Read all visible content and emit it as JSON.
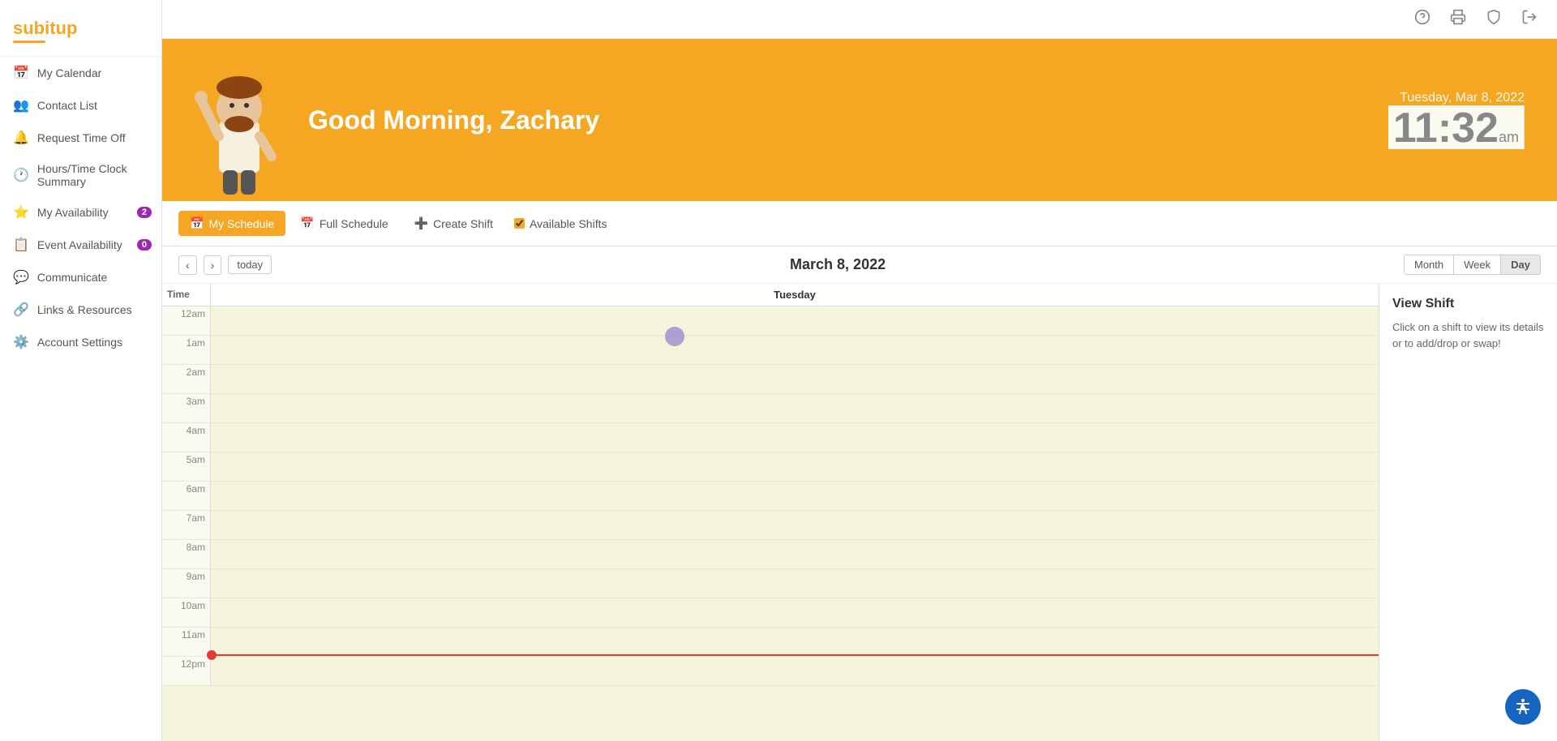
{
  "app": {
    "logo": "subitup",
    "logo_tagline": "~"
  },
  "topbar": {
    "icons": [
      "help-icon",
      "print-icon",
      "shield-icon",
      "power-icon"
    ]
  },
  "hero": {
    "greeting": "Good Morning, Zachary",
    "date_label": "Tuesday, Mar 8, 2022",
    "time_value": "11:32",
    "time_ampm": "am"
  },
  "sidebar": {
    "items": [
      {
        "id": "my-calendar",
        "label": "My Calendar",
        "icon": "📅",
        "badge": null
      },
      {
        "id": "contact-list",
        "label": "Contact List",
        "icon": "👥",
        "badge": null
      },
      {
        "id": "request-time-off",
        "label": "Request Time Off",
        "icon": "🔔",
        "badge": null
      },
      {
        "id": "hours-time-clock",
        "label": "Hours/Time Clock Summary",
        "icon": "🕐",
        "badge": null
      },
      {
        "id": "my-availability",
        "label": "My Availability",
        "icon": "⭐",
        "badge": "2"
      },
      {
        "id": "event-availability",
        "label": "Event Availability",
        "icon": "📋",
        "badge": "0"
      },
      {
        "id": "communicate",
        "label": "Communicate",
        "icon": "💬",
        "badge": null
      },
      {
        "id": "links-resources",
        "label": "Links & Resources",
        "icon": "🔗",
        "badge": null
      },
      {
        "id": "account-settings",
        "label": "Account Settings",
        "icon": "⚙️",
        "badge": null
      }
    ]
  },
  "tabs": [
    {
      "id": "my-schedule",
      "label": "My Schedule",
      "icon": "📅",
      "active": true
    },
    {
      "id": "full-schedule",
      "label": "Full Schedule",
      "icon": "📅",
      "active": false
    },
    {
      "id": "create-shift",
      "label": "Create Shift",
      "icon": "➕",
      "active": false
    }
  ],
  "available_shifts": {
    "label": "Available Shifts",
    "checked": true
  },
  "calendar": {
    "title": "March 8, 2022",
    "day_label": "Tuesday",
    "nav_prev": "‹",
    "nav_next": "›",
    "today_label": "today",
    "view_buttons": [
      {
        "label": "Month",
        "active": false
      },
      {
        "label": "Week",
        "active": false
      },
      {
        "label": "Day",
        "active": true
      }
    ],
    "time_col_header": "Time",
    "time_slots": [
      "12am",
      "1am",
      "2am",
      "3am",
      "4am",
      "5am",
      "6am",
      "7am",
      "8am",
      "9am",
      "10am",
      "11am",
      "12pm"
    ],
    "current_time_row": "11am"
  },
  "view_shift": {
    "title": "View Shift",
    "description": "Click on a shift to view its details or to add/drop or swap!"
  }
}
